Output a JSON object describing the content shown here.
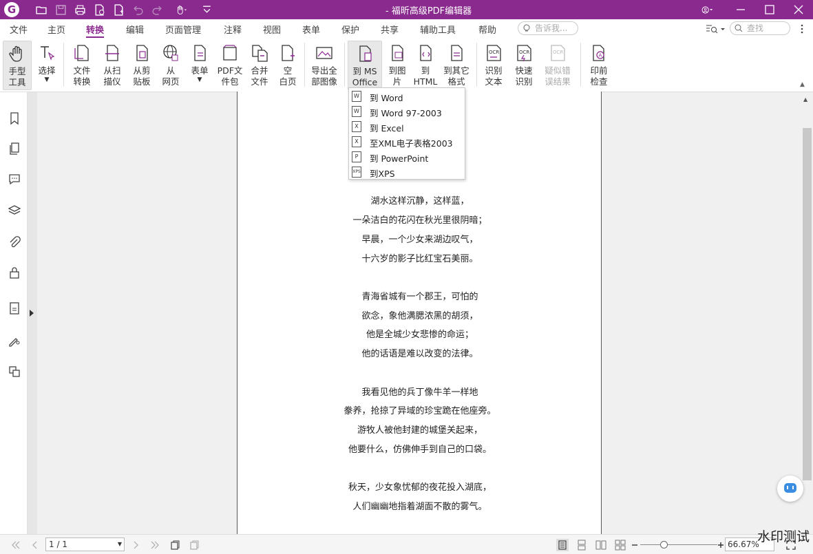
{
  "titlebar": {
    "title": "- 福昕高级PDF编辑器",
    "logo": "foxit-logo"
  },
  "menu": {
    "items": [
      "文件",
      "主页",
      "转换",
      "编辑",
      "页面管理",
      "注释",
      "视图",
      "表单",
      "保护",
      "共享",
      "辅助工具",
      "帮助"
    ],
    "active": "转换",
    "tell_me_placeholder": "告诉我...",
    "search_placeholder": "查找"
  },
  "ribbon": {
    "hand_tool": "手型\n工具",
    "select": "选择",
    "file_convert": "文件\n转换",
    "from_scan": "从扫\n描仪",
    "from_clipboard": "从剪\n贴板",
    "from_web": "从\n网页",
    "form": "表单",
    "pdf_package": "PDF文\n件包",
    "combine": "合并\n文件",
    "blank_page": "空\n白页",
    "export_images": "导出全\n部图像",
    "to_ms_office": "到 MS\nOffice",
    "to_image": "到图\n片",
    "to_html": "到\nHTML",
    "to_other": "到其它\n格式",
    "ocr_text": "识别\n文本",
    "quick_ocr": "快速\n识别",
    "suspect_results": "疑似错\n误结果",
    "preflight": "印前\n检查"
  },
  "dropdown": {
    "items": [
      {
        "label": "到 Word",
        "icon": "W"
      },
      {
        "label": "到 Word 97-2003",
        "icon": "W"
      },
      {
        "label": "到 Excel",
        "icon": "X"
      },
      {
        "label": "至XML电子表格2003",
        "icon": "X"
      },
      {
        "label": "到 PowerPoint",
        "icon": "P"
      },
      {
        "label": "到XPS",
        "icon": "XPS"
      }
    ]
  },
  "document": {
    "stanzas": [
      [
        "湖水这样沉静，这样蓝，",
        "一朵洁白的花闪在秋光里很阴暗；",
        "早晨，一个少女来湖边叹气，",
        "十六岁的影子比红宝石美丽。"
      ],
      [
        "青海省城有一个郡王，可怕的",
        "欲念，象他满腮浓黑的胡须，",
        "他是全城少女悲惨的命运；",
        "他的话语是难以改变的法律。"
      ],
      [
        "我看见他的兵丁像牛羊一样地",
        "豢养，抢掠了异域的珍宝跪在他座旁。",
        "游牧人被他封建的城堡关起来，",
        "他要什么，仿佛伸手到自己的口袋。"
      ],
      [
        "秋天，少女象忧郁的夜花投入湖底，",
        "人们幽幽地指着湖面不散的雾气。"
      ]
    ]
  },
  "statusbar": {
    "page_indicator": "1 / 1",
    "zoom": "66.67%"
  },
  "watermark": "水印测试",
  "colors": {
    "accent": "#8a2a8f"
  }
}
